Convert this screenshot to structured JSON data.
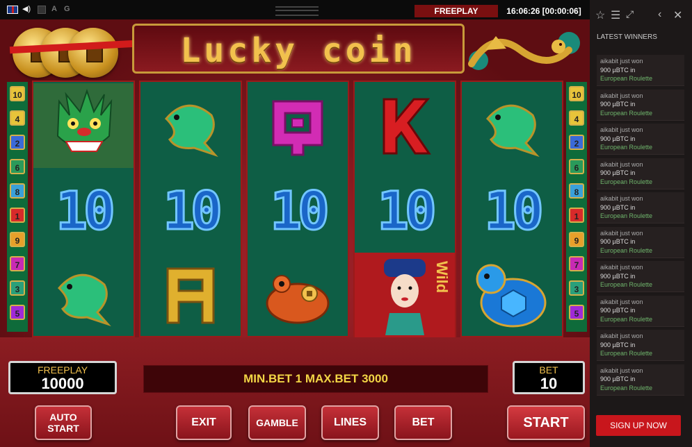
{
  "topbar": {
    "letters": [
      "A",
      "G"
    ],
    "mode": "FREEPLAY",
    "clock": "16:06:26 [00:00:06]"
  },
  "logo": {
    "text": "Lucky coin"
  },
  "colors": {
    "reel_bg": "#0e5e45",
    "frame": "#7a1418",
    "gold": "#f2c14d",
    "message": "#f2d545",
    "signup": "#c8161c"
  },
  "line_numbers_left": [
    "10",
    "4",
    "2",
    "6",
    "8",
    "1",
    "9",
    "7",
    "3",
    "5"
  ],
  "line_numbers_right": [
    "10",
    "4",
    "2",
    "6",
    "8",
    "1",
    "9",
    "7",
    "3",
    "5"
  ],
  "reels": [
    [
      "dragon-symbol",
      "ten-symbol",
      "fish-symbol"
    ],
    [
      "fish-symbol",
      "ten-symbol",
      "a-symbol"
    ],
    [
      "q-symbol",
      "ten-symbol",
      "frog-symbol"
    ],
    [
      "k-symbol",
      "ten-symbol",
      "wild-lady-symbol"
    ],
    [
      "fish-symbol",
      "ten-symbol",
      "turtle-symbol"
    ]
  ],
  "ten_text": "10",
  "wild_text": "Wild",
  "freeplay": {
    "label": "FREEPLAY",
    "value": "10000"
  },
  "message": "MIN.BET 1 MAX.BET 3000",
  "bet": {
    "label": "BET",
    "value": "10"
  },
  "buttons": {
    "autostart_line1": "AUTO",
    "autostart_line2": "START",
    "exit": "EXIT",
    "gamble": "GAMBLE",
    "lines": "LINES",
    "bet": "BET",
    "start": "START"
  },
  "sidebar": {
    "title": "LATEST WINNERS",
    "winners": [
      {
        "line1": "aikabit just won",
        "line2": "900 µBTC in",
        "line3": "European Roulette"
      },
      {
        "line1": "aikabit just won",
        "line2": "900 µBTC in",
        "line3": "European Roulette"
      },
      {
        "line1": "aikabit just won",
        "line2": "900 µBTC in",
        "line3": "European Roulette"
      },
      {
        "line1": "aikabit just won",
        "line2": "900 µBTC in",
        "line3": "European Roulette"
      },
      {
        "line1": "aikabit just won",
        "line2": "900 µBTC in",
        "line3": "European Roulette"
      },
      {
        "line1": "aikabit just won",
        "line2": "900 µBTC in",
        "line3": "European Roulette"
      },
      {
        "line1": "aikabit just won",
        "line2": "900 µBTC in",
        "line3": "European Roulette"
      },
      {
        "line1": "aikabit just won",
        "line2": "900 µBTC in",
        "line3": "European Roulette"
      },
      {
        "line1": "aikabit just won",
        "line2": "900 µBTC in",
        "line3": "European Roulette"
      },
      {
        "line1": "aikabit just won",
        "line2": "900 µBTC in",
        "line3": "European Roulette"
      }
    ],
    "signup": "SIGN UP NOW"
  }
}
